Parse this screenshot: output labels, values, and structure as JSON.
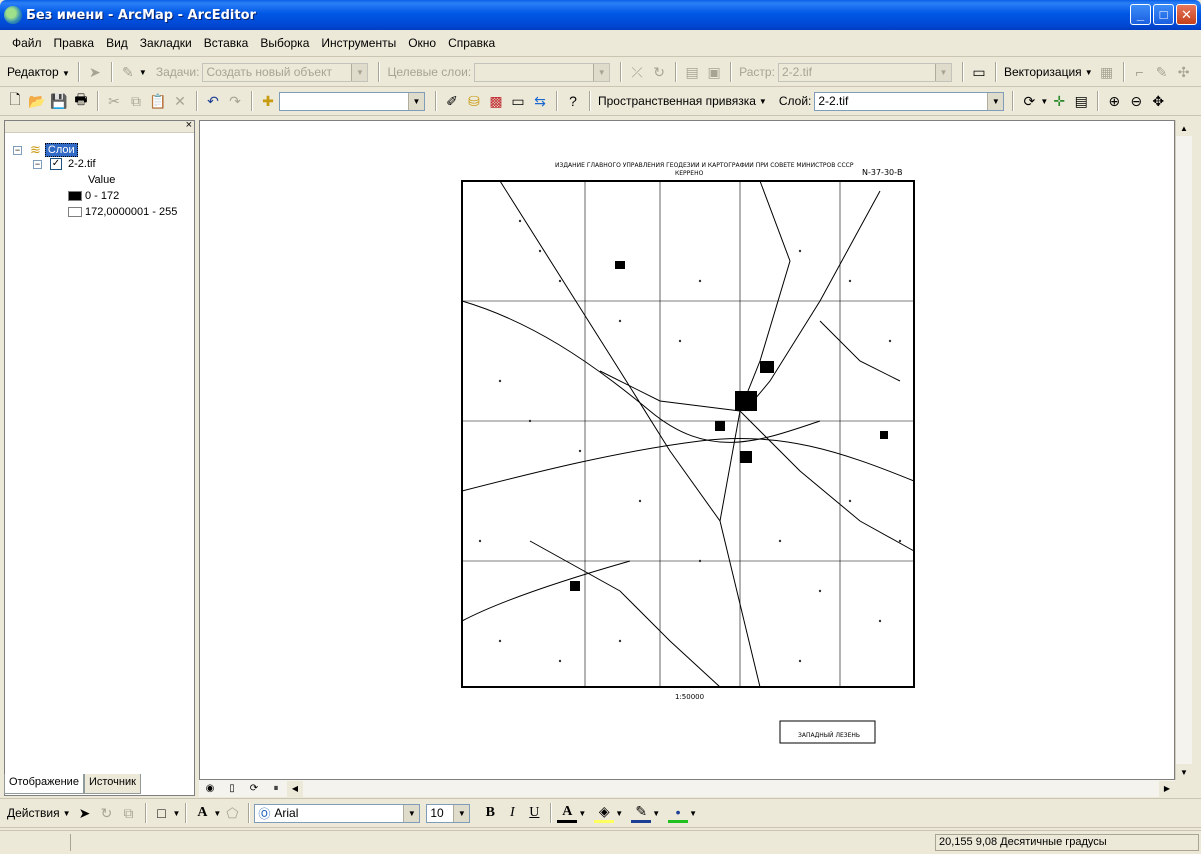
{
  "window": {
    "title": "Без имени - ArcMap - ArcEditor",
    "minimize": "_",
    "maximize": "□",
    "close": "✕"
  },
  "menu": [
    "Файл",
    "Правка",
    "Вид",
    "Закладки",
    "Вставка",
    "Выборка",
    "Инструменты",
    "Окно",
    "Справка"
  ],
  "editor_toolbar": {
    "editor_label": "Редактор",
    "task_label": "Задачи:",
    "task_value": "Создать новый объект",
    "target_label": "Целевые слои:",
    "target_value": "",
    "raster_label": "Растр:",
    "raster_value": "2-2.tif",
    "vectorize_label": "Векторизация"
  },
  "standard_toolbar": {
    "scale_value": "",
    "georef_label": "Пространственная привязка",
    "layer_label": "Слой:",
    "layer_value": "2-2.tif"
  },
  "toc": {
    "root_label": "Слои",
    "layer_name": "2-2.tif",
    "field_label": "Value",
    "classes": [
      {
        "label": "0 - 172",
        "color": "#000000"
      },
      {
        "label": "172,0000001 - 255",
        "color": "#ffffff"
      }
    ],
    "tabs": [
      "Отображение",
      "Источник"
    ]
  },
  "draw_toolbar": {
    "actions_label": "Действия",
    "font_value": "Arial",
    "size_value": "10",
    "bold": "B",
    "italic": "I",
    "underline": "U"
  },
  "status": {
    "coords": "20,155  9,08 Десятичные градусы"
  },
  "map": {
    "header_text": "ИЗДАНИЕ ГЛАВНОГО УПРАВЛЕНИЯ ГЕОДЕЗИИ И КАРТОГРАФИИ ПРИ СОВЕТЕ МИНИСТРОВ СССР",
    "sheet_name": "КЕРРЕНО",
    "sheet_code": "N-37-30-В",
    "scale_text": "1:50000",
    "bottom_note": "ЗАПАДНЫЙ ЛЕЗЕНЬ"
  }
}
